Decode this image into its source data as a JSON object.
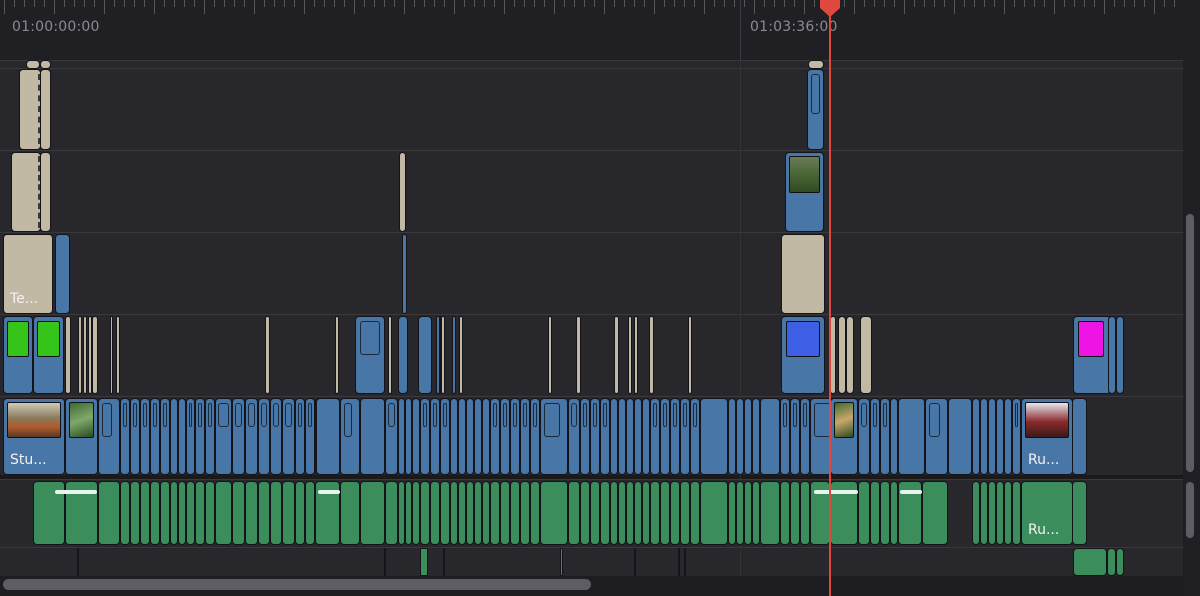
{
  "ruler": {
    "start_timecode": "01:00:00:00",
    "marker_timecode": "01:03:36:00"
  },
  "clips": {
    "title_label": "Te...",
    "studio_label": "Stu...",
    "run_video_label": "Ru...",
    "run_audio_label": "Ru..."
  },
  "colors": {
    "video_clip": "#4876a7",
    "title_clip": "#c1b9a4",
    "audio_clip": "#3c8d5c",
    "solid_green": "#35c41a",
    "solid_blue": "#3d5fe6",
    "solid_magenta": "#ee14e6",
    "playhead": "#e0483f"
  },
  "icons": {
    "playhead": "playhead-marker-icon"
  }
}
